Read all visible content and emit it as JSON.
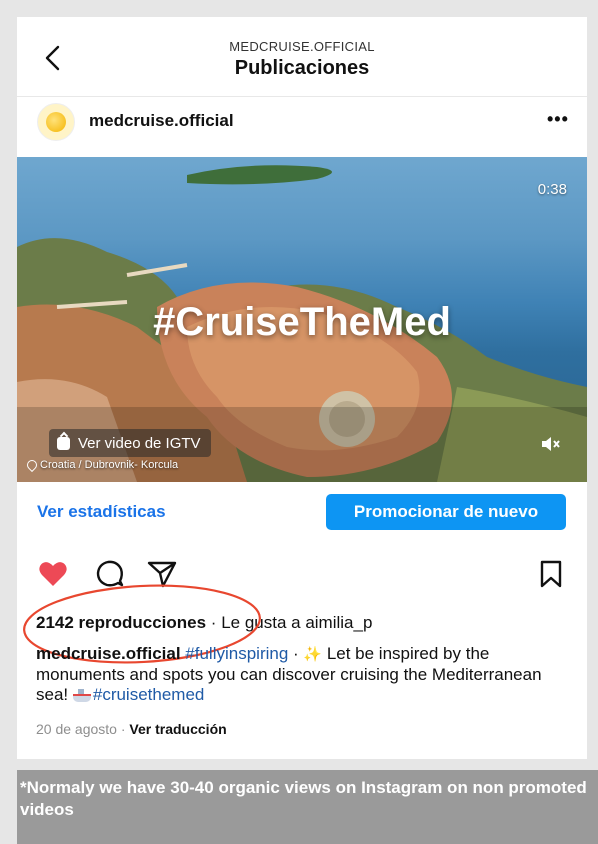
{
  "header": {
    "account": "MEDCRUISE.OFFICIAL",
    "title": "Publicaciones"
  },
  "post": {
    "username": "medcruise.official",
    "more_label": "•••",
    "media": {
      "duration": "0:38",
      "hashtag_overlay": "#CruiseTheMed",
      "igtv_label": "Ver video de IGTV",
      "location": "Croatia / Dubrovnik- Korcula"
    },
    "stats_link": "Ver estadísticas",
    "promote_label": "Promocionar de nuevo",
    "views": "2142 reproducciones",
    "separator": " · ",
    "likes_prefix": "Le gusta a ",
    "liked_by": "aimilia_p",
    "caption": {
      "author": "medcruise.official",
      "tag1": "#fullyinspiring",
      "mid": " · ",
      "text": " Let be inspired by the monuments and spots you can discover cruising the Mediterranean sea! ",
      "tag2": "#cruisethemed"
    },
    "date": "20 de agosto",
    "translate": "Ver traducción"
  },
  "icons": [
    "back-chevron-icon",
    "more-icon",
    "igtv-icon",
    "mute-icon",
    "heart-icon",
    "comment-icon",
    "share-icon",
    "bookmark-icon"
  ],
  "colors": {
    "link_blue": "#1a73e8",
    "button_blue": "#0d95f3",
    "like_red": "#ed4956",
    "annotation_red": "#e8472f"
  },
  "footnote": "*Normaly we have 30-40 organic views on Instagram on non promoted videos"
}
